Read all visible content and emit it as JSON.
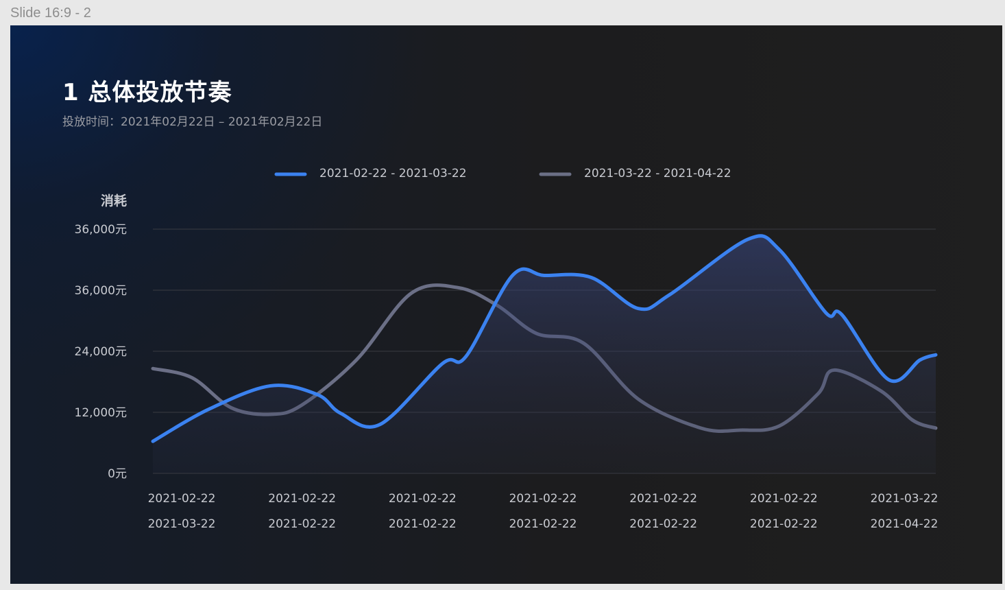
{
  "frame": {
    "label": "Slide 16:9 - 2"
  },
  "header": {
    "title": "1 总体投放节奏",
    "subtitle": "投放时间：2021年02月22日 –  2021年02月22日"
  },
  "colors": {
    "series1": "#3b82f0",
    "series2": "#6b6f86",
    "grid": "#3a3b42",
    "text": "#c9cbd1"
  },
  "chart_data": {
    "type": "line",
    "ylabel": "消耗",
    "yticks": [
      "0元",
      "12,000元",
      "24,000元",
      "36,000元",
      "36,000元"
    ],
    "ylim": [
      0,
      48000
    ],
    "grid": true,
    "legend_position": "top-center",
    "x_tick_labels": [
      {
        "top": "2021-02-22",
        "bottom": "2021-03-22"
      },
      {
        "top": "2021-02-22",
        "bottom": "2021-02-22"
      },
      {
        "top": "2021-02-22",
        "bottom": "2021-02-22"
      },
      {
        "top": "2021-02-22",
        "bottom": "2021-02-22"
      },
      {
        "top": "2021-02-22",
        "bottom": "2021-02-22"
      },
      {
        "top": "2021-02-22",
        "bottom": "2021-02-22"
      },
      {
        "top": "2021-03-22",
        "bottom": "2021-04-22"
      }
    ],
    "series": [
      {
        "name": "2021-02-22 -  2021-03-22",
        "area": true,
        "points": [
          [
            0.0,
            6300
          ],
          [
            0.07,
            12500
          ],
          [
            0.15,
            17200
          ],
          [
            0.21,
            15500
          ],
          [
            0.24,
            11800
          ],
          [
            0.29,
            9600
          ],
          [
            0.37,
            21600
          ],
          [
            0.4,
            23000
          ],
          [
            0.46,
            39000
          ],
          [
            0.5,
            38900
          ],
          [
            0.56,
            38500
          ],
          [
            0.62,
            32400
          ],
          [
            0.66,
            35100
          ],
          [
            0.76,
            46000
          ],
          [
            0.8,
            44000
          ],
          [
            0.86,
            31500
          ],
          [
            0.88,
            31200
          ],
          [
            0.94,
            18400
          ],
          [
            0.98,
            22300
          ],
          [
            1.0,
            23300
          ]
        ]
      },
      {
        "name": "2021-03-22 -  2021-04-22",
        "area": false,
        "points": [
          [
            0.0,
            20600
          ],
          [
            0.05,
            18800
          ],
          [
            0.1,
            12900
          ],
          [
            0.15,
            11600
          ],
          [
            0.19,
            13400
          ],
          [
            0.26,
            22300
          ],
          [
            0.33,
            35400
          ],
          [
            0.39,
            36500
          ],
          [
            0.44,
            33000
          ],
          [
            0.49,
            27500
          ],
          [
            0.55,
            25600
          ],
          [
            0.62,
            14600
          ],
          [
            0.7,
            8900
          ],
          [
            0.75,
            8500
          ],
          [
            0.8,
            9300
          ],
          [
            0.85,
            15700
          ],
          [
            0.87,
            20300
          ],
          [
            0.93,
            16200
          ],
          [
            0.97,
            10500
          ],
          [
            1.0,
            8900
          ]
        ]
      }
    ]
  }
}
